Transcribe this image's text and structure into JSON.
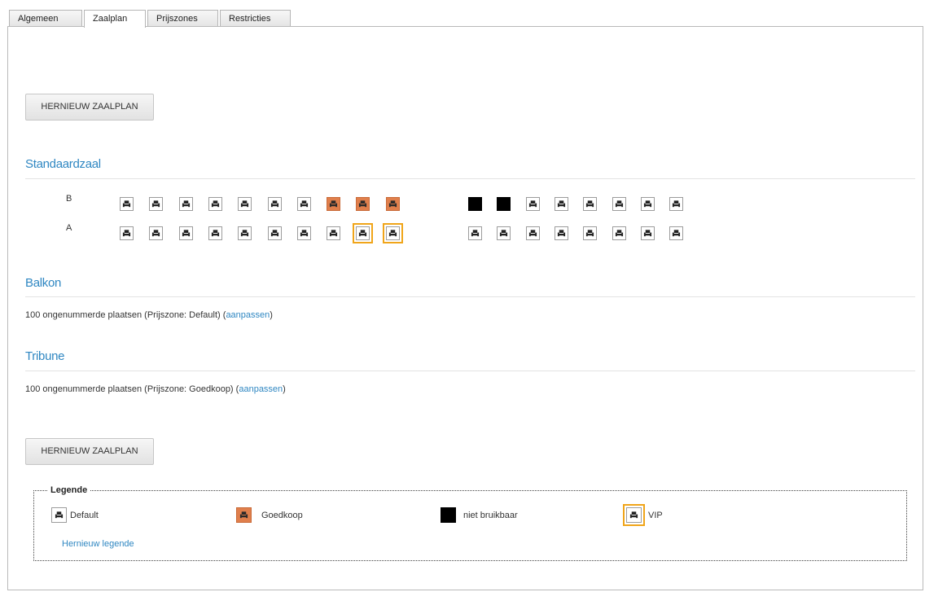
{
  "tabs": [
    {
      "label": "Algemeen",
      "active": false
    },
    {
      "label": "Zaalplan",
      "active": true
    },
    {
      "label": "Prijszones",
      "active": false
    },
    {
      "label": "Restricties",
      "active": false
    }
  ],
  "renew_button_label": "HERNIEUW ZAALPLAN",
  "sections": {
    "standaardzaal": {
      "title": "Standaardzaal",
      "rows": [
        {
          "label": "B",
          "seats": [
            "default",
            "default",
            "default",
            "default",
            "default",
            "default",
            "default",
            "goedkoop",
            "goedkoop",
            "goedkoop",
            "niet-bruikbaar",
            "niet-bruikbaar",
            "default",
            "default",
            "default",
            "default",
            "default",
            "default"
          ]
        },
        {
          "label": "A",
          "seats": [
            "default",
            "default",
            "default",
            "default",
            "default",
            "default",
            "default",
            "default",
            "vip",
            "vip",
            "default",
            "default",
            "default",
            "default",
            "default",
            "default",
            "default",
            "default"
          ]
        }
      ]
    },
    "balkon": {
      "title": "Balkon",
      "info_text": "100 ongenummerde plaatsen (Prijszone: Default)",
      "link_label": "aanpassen"
    },
    "tribune": {
      "title": "Tribune",
      "info_text": "100 ongenummerde plaatsen (Prijszone: Goedkoop)",
      "link_label": "aanpassen"
    }
  },
  "legend": {
    "title": "Legende",
    "items": [
      {
        "type": "default",
        "label": "Default"
      },
      {
        "type": "goedkoop",
        "label": "Goedkoop"
      },
      {
        "type": "niet-bruikbaar",
        "label": "niet bruikbaar"
      },
      {
        "type": "vip",
        "label": "VIP"
      }
    ],
    "renew_link": "Hernieuw legende"
  },
  "colors": {
    "accent": "#2f87c2",
    "goedkoop": "#e07f4c",
    "niet_bruikbaar": "#000000",
    "vip_outline": "#f0a51a"
  },
  "icons": {
    "seat": "seat-icon"
  }
}
